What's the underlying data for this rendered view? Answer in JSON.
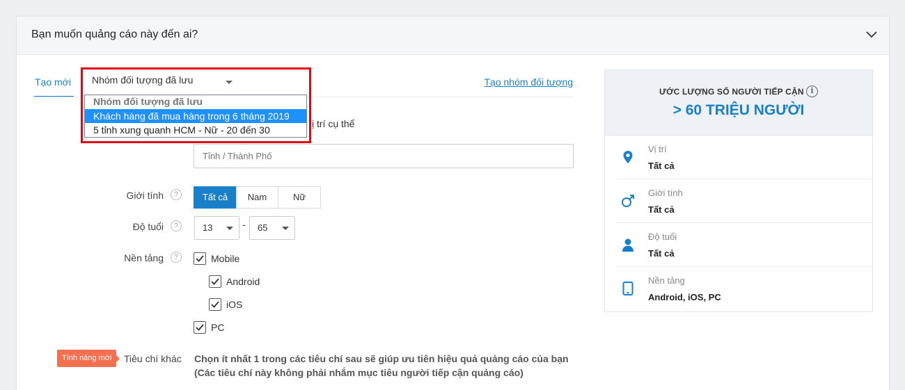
{
  "header": {
    "title": "Bạn muốn quảng cáo này đến ai?"
  },
  "tabs": {
    "new_label": "Tạo mới",
    "saved_select_label": "Nhóm đối tượng đã lưu",
    "create_group_link": "Tạo nhóm đối tượng"
  },
  "saved_dropdown": {
    "header": "Nhóm đối tượng đã lưu",
    "options": [
      {
        "label": "Khách hàng đã mua hàng trong 6 tháng 2019",
        "selected": true
      },
      {
        "label": "5 tỉnh xung quanh HCM - Nữ - 20 đến 30",
        "selected": false
      }
    ]
  },
  "location": {
    "hint_fragment": "ị trí cụ thể",
    "placeholder": "Tỉnh / Thành Phố"
  },
  "gender": {
    "label": "Giới tính",
    "help": "?",
    "options": [
      "Tất cả",
      "Nam",
      "Nữ"
    ],
    "selected": "Tất cả"
  },
  "age": {
    "label": "Độ tuổi",
    "help": "?",
    "min": "13",
    "max": "65",
    "separator": "-"
  },
  "platform": {
    "label": "Nền tảng",
    "help": "?",
    "items": [
      {
        "label": "Mobile",
        "checked": true
      },
      {
        "label": "Android",
        "checked": true
      },
      {
        "label": "iOS",
        "checked": true
      },
      {
        "label": "PC",
        "checked": true
      }
    ]
  },
  "other_criteria": {
    "badge": "Tính năng mới",
    "label": "Tiêu chí khác",
    "desc_line1": "Chọn ít nhất 1 trong các tiêu chí sau sẽ giúp ưu tiên hiệu quả quảng cáo của bạn",
    "desc_line2": "(Các tiêu chí này không phải nhắm mục tiêu người tiếp cận quảng cáo)"
  },
  "estimate": {
    "caption": "ƯỚC LƯỢNG SỐ NGƯỜI TIẾP CẬN",
    "info": "i",
    "value": "> 60 TRIỆU NGƯỜI",
    "rows": [
      {
        "name": "Vị trí",
        "value": "Tất cả",
        "icon": "location-pin-icon"
      },
      {
        "name": "Giới tính",
        "value": "Tất cả",
        "icon": "male-symbol-icon"
      },
      {
        "name": "Độ tuổi",
        "value": "Tất cả",
        "icon": "person-icon"
      },
      {
        "name": "Nền tảng",
        "value": "Android, iOS, PC",
        "icon": "tablet-icon"
      }
    ]
  },
  "colors": {
    "accent": "#1a7fc9",
    "highlight_frame": "#e30613",
    "badge": "#f36f4f",
    "dropdown_selected": "#1e90ff"
  }
}
